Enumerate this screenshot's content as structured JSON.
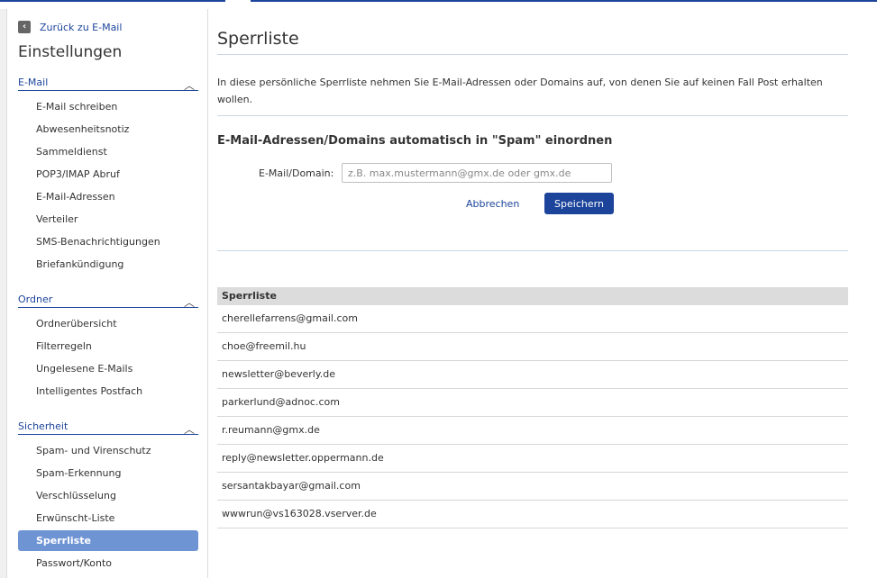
{
  "sidebar": {
    "back_label": "Zurück zu E-Mail",
    "title": "Einstellungen",
    "sections": [
      {
        "title": "E-Mail",
        "items": [
          "E-Mail schreiben",
          "Abwesenheitsnotiz",
          "Sammeldienst",
          "POP3/IMAP Abruf",
          "E-Mail-Adressen",
          "Verteiler",
          "SMS-Benachrichtigungen",
          "Briefankündigung"
        ]
      },
      {
        "title": "Ordner",
        "items": [
          "Ordnerübersicht",
          "Filterregeln",
          "Ungelesene E-Mails",
          "Intelligentes Postfach"
        ]
      },
      {
        "title": "Sicherheit",
        "items": [
          "Spam- und Virenschutz",
          "Spam-Erkennung",
          "Verschlüsselung",
          "Erwünscht-Liste",
          "Sperrliste",
          "Passwort/Konto"
        ]
      }
    ],
    "active_item": "Sperrliste"
  },
  "main": {
    "title": "Sperrliste",
    "intro": "In diese persönliche Sperrliste nehmen Sie E-Mail-Adressen oder Domains auf, von denen Sie auf keinen Fall Post erhalten wollen.",
    "form_title": "E-Mail-Adressen/Domains automatisch in \"Spam\" einordnen",
    "field_label": "E-Mail/Domain:",
    "field_placeholder": "z.B. max.mustermann@gmx.de oder gmx.de",
    "field_value": "",
    "cancel_label": "Abbrechen",
    "save_label": "Speichern",
    "list_header": "Sperrliste",
    "entries": [
      "cherellefarrens@gmail.com",
      "choe@freemil.hu",
      "newsletter@beverly.de",
      "parkerlund@adnoc.com",
      "r.reumann@gmx.de",
      "reply@newsletter.oppermann.de",
      "sersantakbayar@gmail.com",
      "wwwrun@vs163028.vserver.de"
    ]
  },
  "colors": {
    "accent": "#1c449b",
    "active_item_bg": "#6f94d4",
    "list_header_bg": "#dcdcdc"
  },
  "icons": {
    "back": "chevron-left-icon",
    "section_toggle": "chevron-up-icon"
  }
}
